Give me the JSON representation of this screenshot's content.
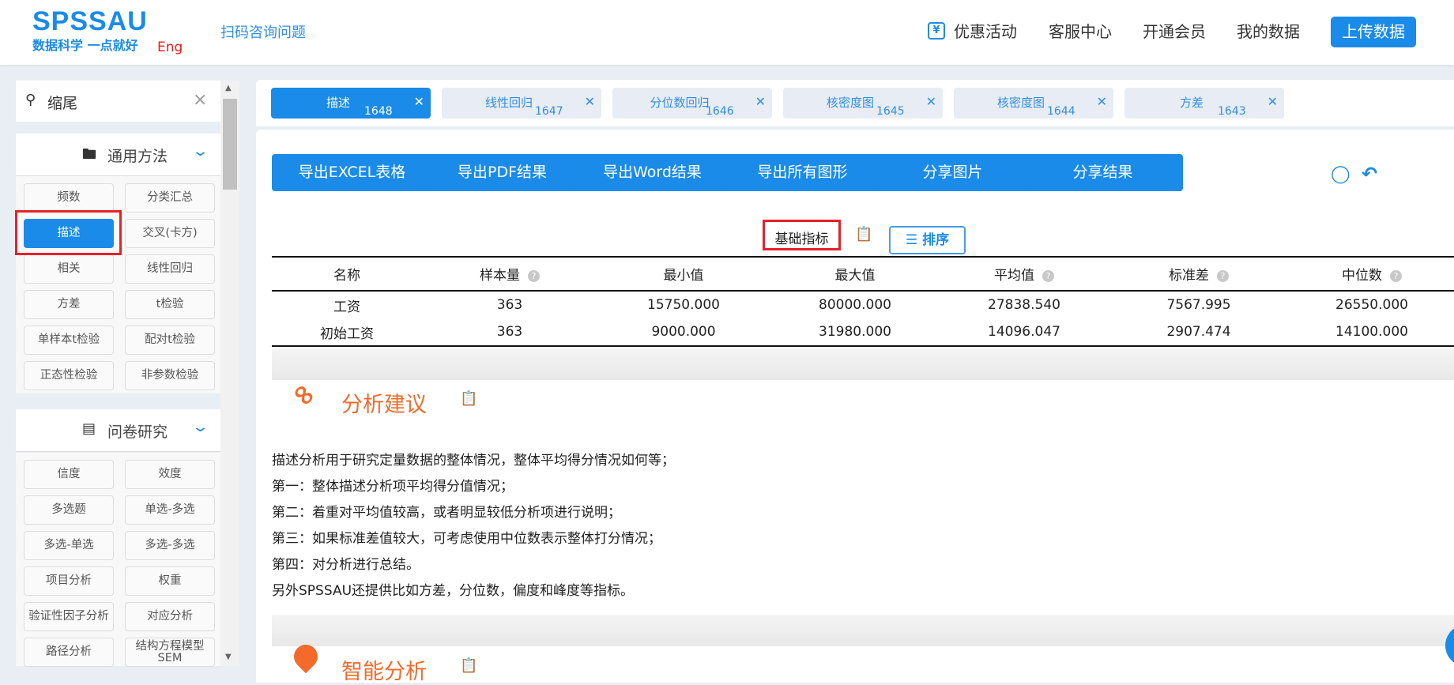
{
  "header": {
    "logo": "SPSSAU",
    "slogan": "数据科学 一点就好",
    "lang": "Eng",
    "scan": "扫码咨询问题",
    "nav": [
      "优惠活动",
      "客服中心",
      "开通会员",
      "我的数据"
    ],
    "upload": "上传数据",
    "promo_icon": "¥"
  },
  "search": {
    "value": "缩尾"
  },
  "sidebar": {
    "sections": [
      {
        "title": "通用方法",
        "items": [
          "频数",
          "分类汇总",
          "描述",
          "交叉(卡方)",
          "相关",
          "线性回归",
          "方差",
          "t检验",
          "单样本t检验",
          "配对t检验",
          "正态性检验",
          "非参数检验"
        ]
      },
      {
        "title": "问卷研究",
        "items": [
          "信度",
          "效度",
          "多选题",
          "单选-多选",
          "多选-单选",
          "多选-多选",
          "项目分析",
          "权重",
          "验证性因子分析",
          "对应分析",
          "路径分析",
          "结构方程模型SEM"
        ]
      }
    ],
    "active": "描述"
  },
  "tabs": [
    {
      "name": "描述",
      "id": "1648"
    },
    {
      "name": "线性回归",
      "id": "1647"
    },
    {
      "name": "分位数回归",
      "id": "1646"
    },
    {
      "name": "核密度图",
      "id": "1645"
    },
    {
      "name": "核密度图",
      "id": "1644"
    },
    {
      "name": "方差",
      "id": "1643"
    }
  ],
  "toolbar": [
    "导出EXCEL表格",
    "导出PDF结果",
    "导出Word结果",
    "导出所有图形",
    "分享图片",
    "分享结果"
  ],
  "table": {
    "title": "基础指标",
    "sort": "排序",
    "headers": [
      "名称",
      "样本量",
      "最小值",
      "最大值",
      "平均值",
      "标准差",
      "中位数"
    ],
    "rows": [
      [
        "工资",
        "363",
        "15750.000",
        "80000.000",
        "27838.540",
        "7567.995",
        "26550.000"
      ],
      [
        "初始工资",
        "363",
        "9000.000",
        "31980.000",
        "14096.047",
        "2907.474",
        "14100.000"
      ]
    ]
  },
  "advice": {
    "title": "分析建议",
    "lines": [
      "描述分析用于研究定量数据的整体情况，整体平均得分情况如何等；",
      "第一：整体描述分析项平均得分值情况；",
      "第二：着重对平均值较高，或者明显较低分析项进行说明；",
      "第三：如果标准差值较大，可考虑使用中位数表示整体打分情况；",
      "第四：对分析进行总结。",
      "另外SPSSAU还提供比如方差，分位数，偏度和峰度等指标。"
    ]
  },
  "smart": {
    "title": "智能分析"
  },
  "colors": {
    "primary": "#1a8be8",
    "accent": "#f26b2b",
    "highlight": "#e8202a"
  }
}
